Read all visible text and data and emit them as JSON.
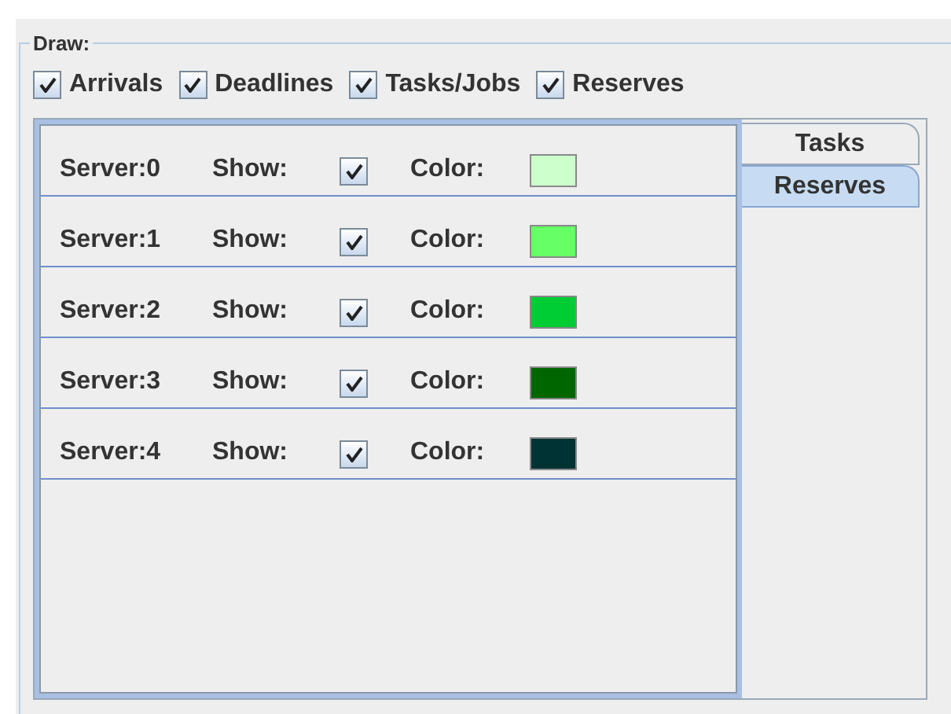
{
  "group": {
    "title": "Draw:"
  },
  "draw_options": [
    {
      "label": "Arrivals",
      "checked": true
    },
    {
      "label": "Deadlines",
      "checked": true
    },
    {
      "label": "Tasks/Jobs",
      "checked": true
    },
    {
      "label": "Reserves",
      "checked": true
    }
  ],
  "tabs": [
    {
      "label": "Tasks",
      "selected": false
    },
    {
      "label": "Reserves",
      "selected": true
    }
  ],
  "servers": [
    {
      "name": "Server:0",
      "show_label": "Show:",
      "show": true,
      "color_label": "Color:",
      "color": "#ccffcc"
    },
    {
      "name": "Server:1",
      "show_label": "Show:",
      "show": true,
      "color_label": "Color:",
      "color": "#66ff66"
    },
    {
      "name": "Server:2",
      "show_label": "Show:",
      "show": true,
      "color_label": "Color:",
      "color": "#00cc33"
    },
    {
      "name": "Server:3",
      "show_label": "Show:",
      "show": true,
      "color_label": "Color:",
      "color": "#006600"
    },
    {
      "name": "Server:4",
      "show_label": "Show:",
      "show": true,
      "color_label": "Color:",
      "color": "#003333"
    }
  ]
}
